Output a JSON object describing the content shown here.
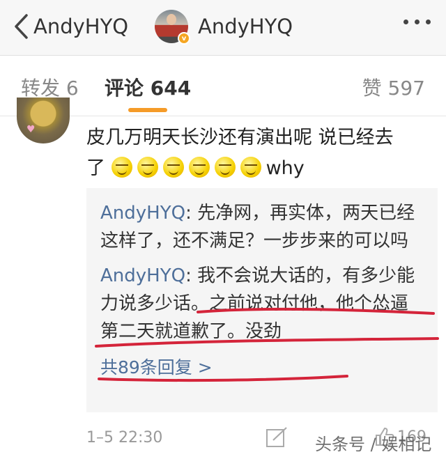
{
  "header": {
    "back_label": "AndyHYQ",
    "title": "AndyHYQ",
    "verified_badge": "v",
    "more_icon": "more-dots-icon"
  },
  "tabs": [
    {
      "label": "转发 6",
      "active": false
    },
    {
      "label": "评论 644",
      "active": true
    },
    {
      "label": "赞 597",
      "active": false
    }
  ],
  "colors": {
    "accent": "#f59b28",
    "link": "#4e6f9a",
    "annotation": "#d4243a"
  },
  "comment": {
    "text_line1": "皮几万明天长沙还有演出呢 说已经去",
    "text_line2_prefix": "了",
    "emoji_count": 6,
    "text_line2_suffix": "why",
    "replies": [
      {
        "name": "AndyHYQ",
        "text": "先净网，再实体，两天已经这样了，还不满足？一步步来的可以吗"
      },
      {
        "name": "AndyHYQ",
        "text": "我不会说大话的，有多少能力说多少话。之前说对付他，他个怂逼第二天就道歉了。没劲"
      }
    ],
    "more_replies": "共89条回复 >",
    "time": "1–5 22:30",
    "like_count": "169"
  },
  "watermark": "头条号 / 娱相记"
}
